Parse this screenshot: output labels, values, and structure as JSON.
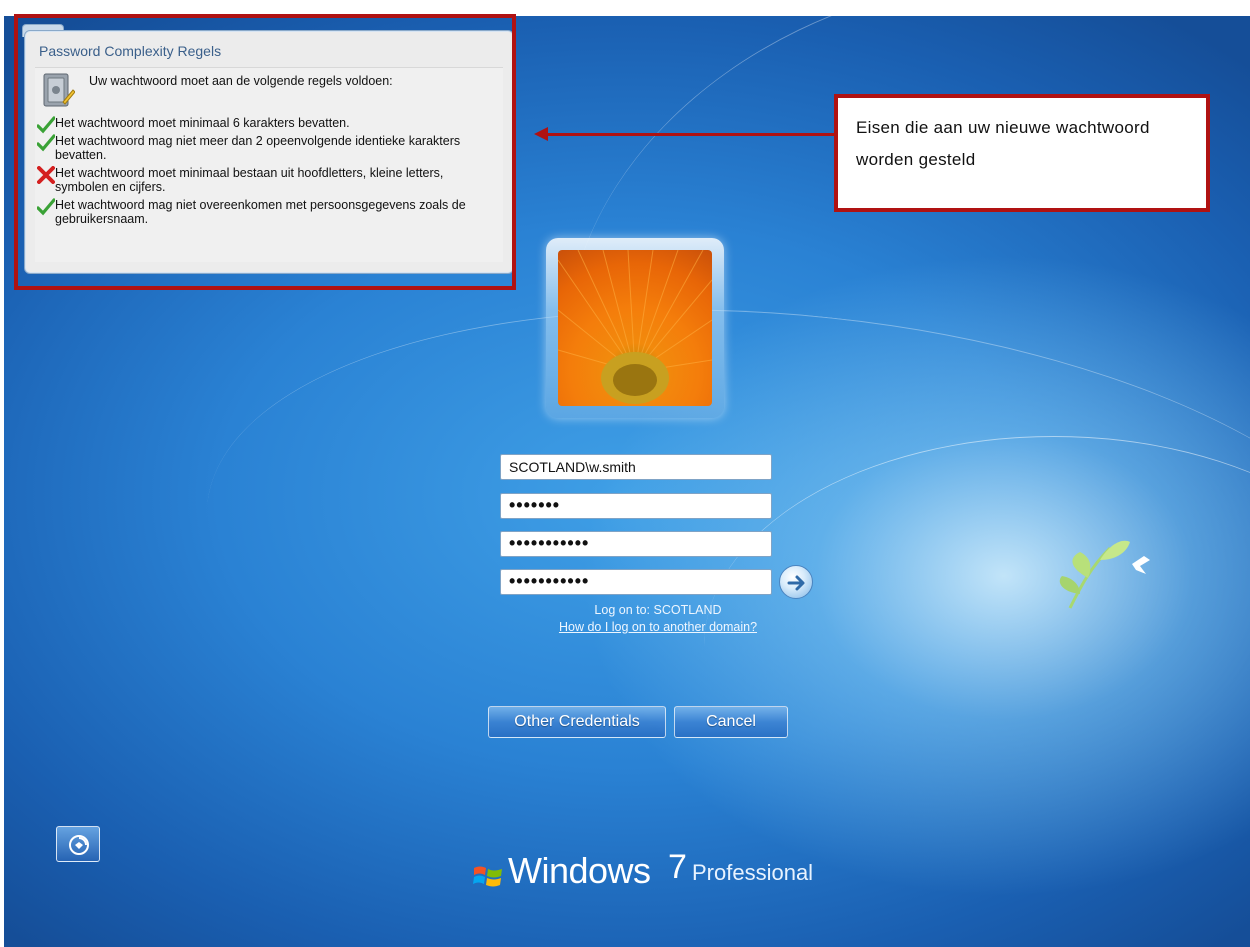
{
  "popup": {
    "title": "Password Complexity Regels",
    "intro": "Uw wachtwoord moet aan de volgende regels voldoen:",
    "rules": [
      {
        "status": "ok",
        "text": "Het wachtwoord moet minimaal 6 karakters bevatten."
      },
      {
        "status": "ok",
        "text": "Het wachtwoord mag niet meer dan 2 opeenvolgende identieke karakters bevatten."
      },
      {
        "status": "fail",
        "text": "Het wachtwoord moet minimaal bestaan uit hoofdletters, kleine letters, symbolen en cijfers."
      },
      {
        "status": "ok",
        "text": "Het wachtwoord mag niet overeenkomen met persoonsgegevens zoals de gebruikersnaam."
      }
    ]
  },
  "callout": {
    "text": "Eisen die aan uw nieuwe wachtwoord worden gesteld"
  },
  "login": {
    "username": "SCOTLAND\\w.smith",
    "old_password_mask": "•••••••",
    "new_password_mask": "•••••••••••",
    "confirm_password_mask": "•••••••••••",
    "logon_to": "Log on to: SCOTLAND",
    "other_domain_link": "How do I log on to another domain?"
  },
  "buttons": {
    "other_credentials": "Other Credentials",
    "cancel": "Cancel"
  },
  "branding": {
    "windows": "Windows",
    "seven": "7",
    "edition": "Professional"
  },
  "icons": {
    "ok": "checkmark-icon",
    "fail": "red-x-icon",
    "submit": "arrow-right-icon",
    "ease_of_access": "ease-of-access-icon",
    "logo": "windows-flag-icon"
  },
  "colors": {
    "highlight_border": "#b01212",
    "ok": "#3aa236",
    "fail": "#d42020"
  }
}
